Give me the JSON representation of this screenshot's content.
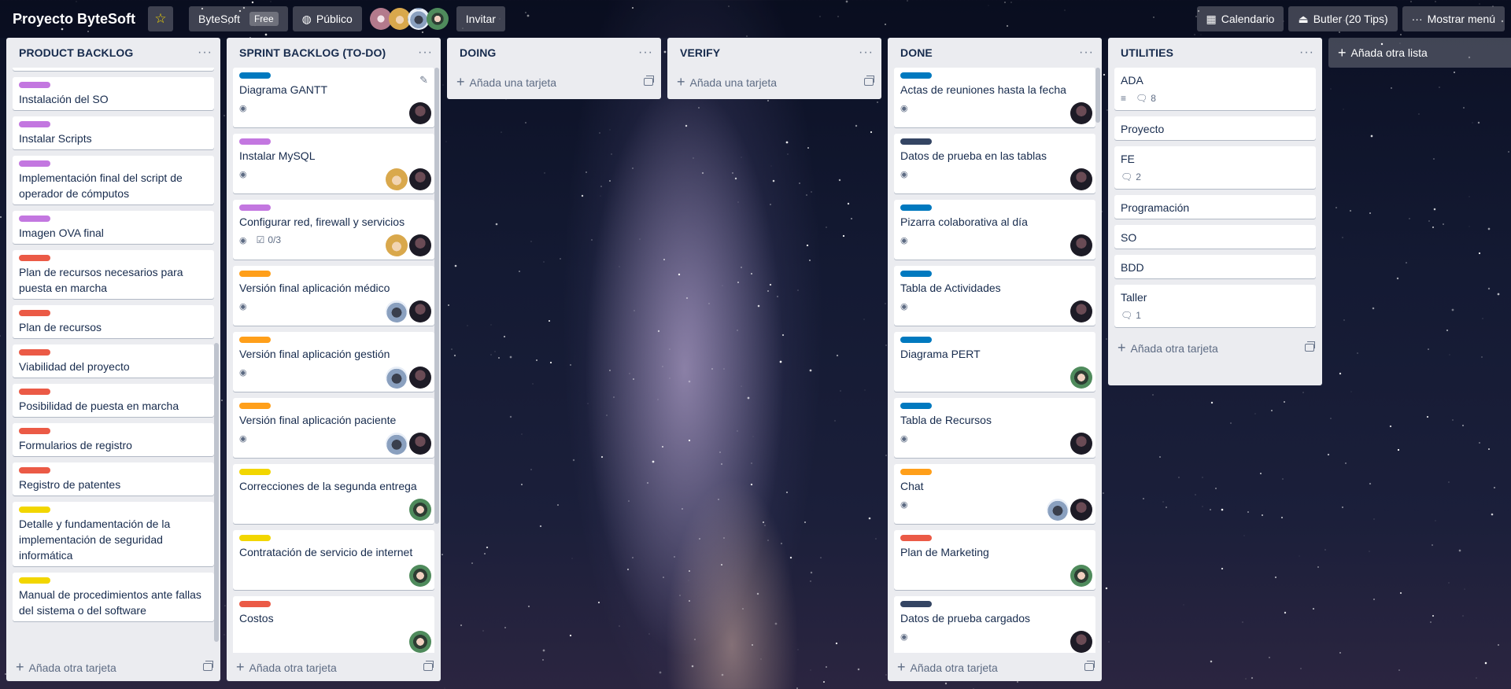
{
  "header": {
    "board_title": "Proyecto ByteSoft",
    "team_name": "ByteSoft",
    "team_badge": "Free",
    "visibility": "Público",
    "invite_label": "Invitar",
    "calendar_label": "Calendario",
    "butler_label": "Butler (20 Tips)",
    "menu_label": "Mostrar menú"
  },
  "colors": {
    "purple": "#c377e0",
    "red": "#eb5a46",
    "yellow": "#f2d600",
    "orange": "#ff9f1a",
    "blue": "#0079bf",
    "navy": "#344563"
  },
  "lists": {
    "backlog": {
      "title": "PRODUCT BACKLOG",
      "add_card": "Añada otra tarjeta",
      "cards": [
        {
          "title": "Instalación del SO"
        },
        {
          "title": "Instalar Scripts"
        },
        {
          "title": "Implementación final del script de operador de cómputos"
        },
        {
          "title": "Imagen OVA final"
        },
        {
          "title": "Plan de recursos necesarios para puesta en marcha"
        },
        {
          "title": "Plan de recursos"
        },
        {
          "title": "Viabilidad del proyecto"
        },
        {
          "title": "Posibilidad de puesta en marcha"
        },
        {
          "title": "Formularios de registro"
        },
        {
          "title": "Registro de patentes"
        },
        {
          "title": "Detalle y fundamentación de la implementación de seguridad informática"
        },
        {
          "title": "Manual de procedimientos ante fallas del sistema o del software"
        }
      ]
    },
    "sprint": {
      "title": "SPRINT BACKLOG (TO-DO)",
      "add_card": "Añada otra tarjeta",
      "cards": [
        {
          "title": "Diagrama GANTT"
        },
        {
          "title": "Instalar MySQL"
        },
        {
          "title": "Configurar red, firewall y servicios",
          "checklist": "0/3"
        },
        {
          "title": "Versión final aplicación médico"
        },
        {
          "title": "Versión final aplicación gestión"
        },
        {
          "title": "Versión final aplicación paciente"
        },
        {
          "title": "Correcciones de la segunda entrega"
        },
        {
          "title": "Contratación de servicio de internet"
        },
        {
          "title": "Costos"
        }
      ]
    },
    "doing": {
      "title": "DOING",
      "add_card": "Añada una tarjeta"
    },
    "verify": {
      "title": "VERIFY",
      "add_card": "Añada una tarjeta"
    },
    "done": {
      "title": "DONE",
      "add_card": "Añada otra tarjeta",
      "cards": [
        {
          "title": "Actas de reuniones hasta la fecha"
        },
        {
          "title": "Datos de prueba en las tablas"
        },
        {
          "title": "Pizarra colaborativa al día"
        },
        {
          "title": "Tabla de Actividades"
        },
        {
          "title": "Diagrama PERT"
        },
        {
          "title": "Tabla de Recursos"
        },
        {
          "title": "Chat"
        },
        {
          "title": "Plan de Marketing"
        },
        {
          "title": "Datos de prueba cargados"
        }
      ]
    },
    "utilities": {
      "title": "UTILITIES",
      "add_card": "Añada otra tarjeta",
      "cards": [
        {
          "title": "ADA",
          "comments": "8"
        },
        {
          "title": "Proyecto"
        },
        {
          "title": "FE",
          "comments": "2"
        },
        {
          "title": "Programación"
        },
        {
          "title": "SO"
        },
        {
          "title": "BDD"
        },
        {
          "title": "Taller",
          "comments": "1"
        }
      ]
    }
  },
  "add_list_label": "Añada otra lista"
}
